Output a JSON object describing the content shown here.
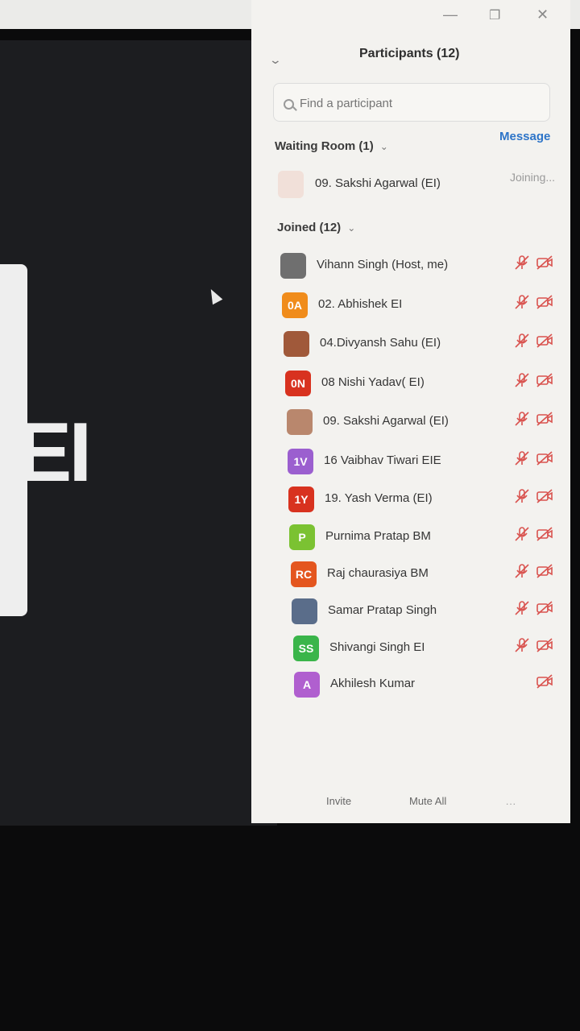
{
  "window": {
    "minimize_icon": "minimize-icon",
    "restore_icon": "restore-icon",
    "close_icon": "close-icon"
  },
  "stage": {
    "shared_text": "EI"
  },
  "panel": {
    "title": "Participants (12)",
    "search_placeholder": "Find a participant",
    "message_label": "Message",
    "waiting_room": {
      "label": "Waiting Room (1)",
      "participant_name": "09. Sakshi Agarwal (EI)",
      "status": "Joining..."
    },
    "joined": {
      "label": "Joined (12)",
      "participants": [
        {
          "initials": "",
          "name": "Vihann Singh (Host, me)",
          "color": "#6f6f6f",
          "photo": true
        },
        {
          "initials": "0A",
          "name": "02. Abhishek EI",
          "color": "#f08c1b"
        },
        {
          "initials": "",
          "name": "04.Divyansh Sahu (EI)",
          "color": "#a0593a",
          "photo": true
        },
        {
          "initials": "0N",
          "name": "08 Nishi Yadav( EI)",
          "color": "#d8321f"
        },
        {
          "initials": "",
          "name": "09. Sakshi Agarwal (EI)",
          "color": "#b9876d",
          "photo": true
        },
        {
          "initials": "1V",
          "name": "16 Vaibhav Tiwari EIE",
          "color": "#9b5fcf"
        },
        {
          "initials": "1Y",
          "name": "19. Yash Verma (EI)",
          "color": "#d8321f"
        },
        {
          "initials": "P",
          "name": "Purnima Pratap BM",
          "color": "#7bc232"
        },
        {
          "initials": "RC",
          "name": "Raj chaurasiya BM",
          "color": "#e4561f"
        },
        {
          "initials": "",
          "name": "Samar Pratap Singh",
          "color": "#5a6d8a",
          "photo": true
        },
        {
          "initials": "SS",
          "name": "Shivangi Singh EI",
          "color": "#3ab54a"
        },
        {
          "initials": "A",
          "name": "Akhilesh Kumar",
          "color": "#b05fcf"
        }
      ]
    },
    "footer": {
      "invite_label": "Invite",
      "mute_all_label": "Mute All",
      "more_label": "..."
    }
  },
  "colors": {
    "accent": "#2d74c8",
    "muted_red": "#d9534f"
  }
}
